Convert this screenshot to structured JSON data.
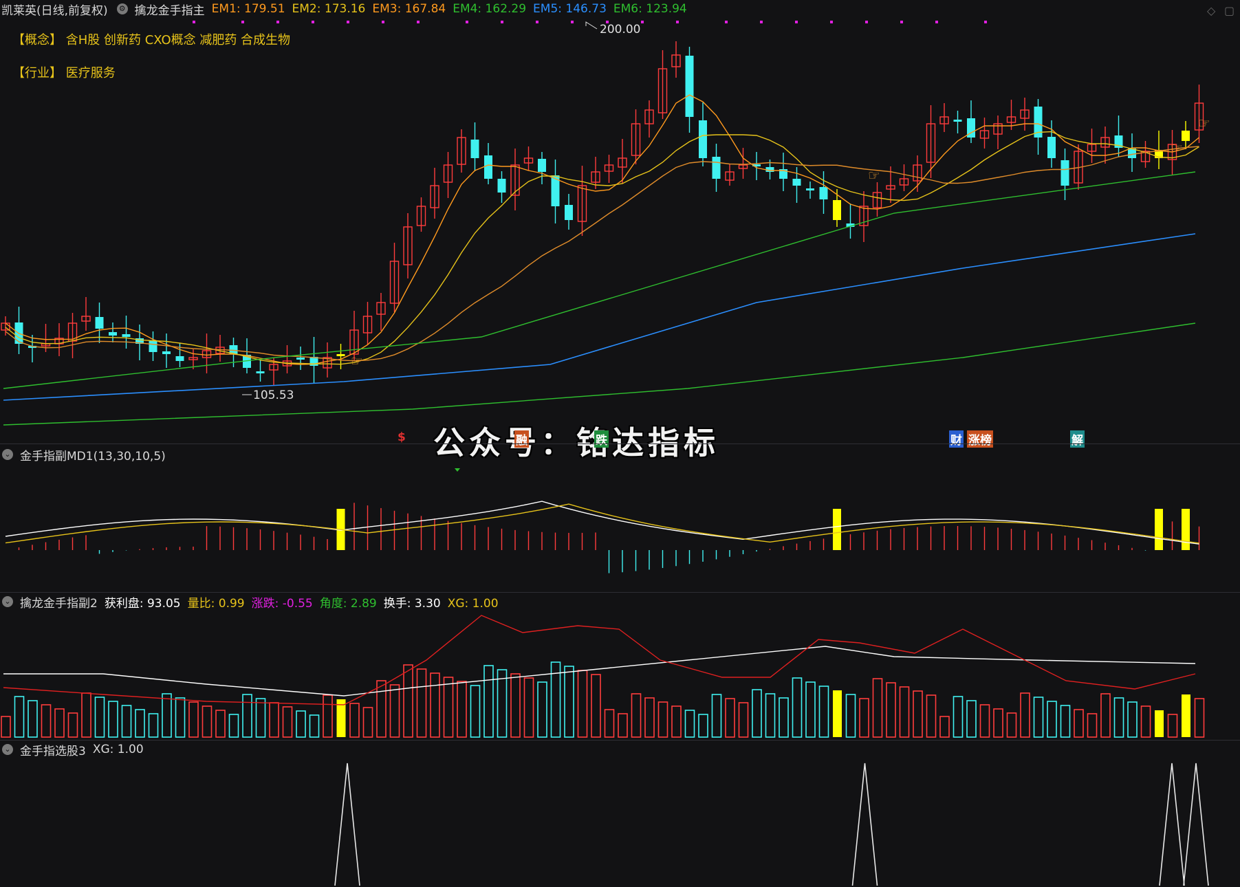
{
  "main": {
    "stock": "凯莱英(日线,前复权)",
    "indicator": "擒龙金手指主",
    "ems": [
      {
        "label": "EM1: 179.51",
        "color": "#ff9a1e"
      },
      {
        "label": "EM2: 173.16",
        "color": "#e7c31a"
      },
      {
        "label": "EM3: 167.84",
        "color": "#ff9a1e"
      },
      {
        "label": "EM4: 162.29",
        "color": "#2fbf2f"
      },
      {
        "label": "EM5: 146.73",
        "color": "#2b8fff"
      },
      {
        "label": "EM6: 123.94",
        "color": "#2fbf2f"
      }
    ],
    "concept": "【概念】 含H股 创新药 CXO概念 减肥药 合成生物",
    "industry": "【行业】 医疗服务",
    "high_label": "200.00",
    "low_label": "105.53"
  },
  "watermark": "公众号：铭达指标",
  "events": [
    {
      "text": "$",
      "color": "#e03030",
      "bg": "transparent"
    },
    {
      "text": "融",
      "color": "#ffffff",
      "bg": "#c8501e"
    },
    {
      "text": "跌",
      "color": "#ffffff",
      "bg": "#1e8c3c"
    },
    {
      "text": "财",
      "color": "#ffffff",
      "bg": "#2a5fd0"
    },
    {
      "text": "涨榜",
      "color": "#ffffff",
      "bg": "#c8501e"
    },
    {
      "text": "解",
      "color": "#ffffff",
      "bg": "#1e8c8c"
    }
  ],
  "sub1": {
    "title": "金手指副MD1(13,30,10,5)"
  },
  "sub2": {
    "title": "擒龙金手指副2",
    "fields": [
      {
        "label": "获利盘: 93.05",
        "color": "#ffffff"
      },
      {
        "label": "量比: 0.99",
        "color": "#e7c31a"
      },
      {
        "label": "涨跌: -0.55",
        "color": "#e020e0"
      },
      {
        "label": "角度: 2.89",
        "color": "#2fbf2f"
      },
      {
        "label": "换手: 3.30",
        "color": "#ffffff"
      },
      {
        "label": "XG: 1.00",
        "color": "#e7c31a"
      }
    ]
  },
  "sub3": {
    "title": "金手指选股3",
    "field": "XG: 1.00"
  },
  "colors": {
    "up": "#ff3c3c",
    "down": "#40f0f0",
    "signal": "#ffff00"
  }
}
